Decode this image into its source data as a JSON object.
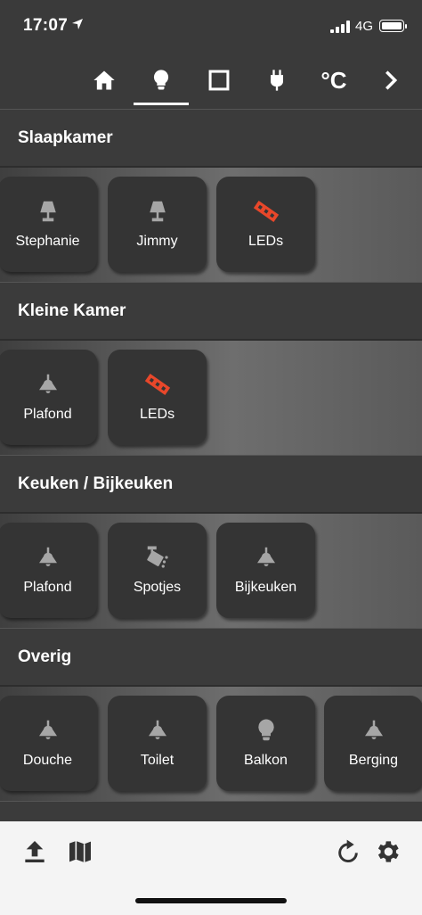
{
  "status_bar": {
    "time": "17:07",
    "network": "4G"
  },
  "top_tabs": [
    {
      "id": "home",
      "icon": "home-icon"
    },
    {
      "id": "lights",
      "icon": "lightbulb-icon",
      "active": true
    },
    {
      "id": "screens",
      "icon": "square-icon"
    },
    {
      "id": "plugs",
      "icon": "plug-icon"
    },
    {
      "id": "temperature",
      "icon": "celsius-icon",
      "label": "°C"
    },
    {
      "id": "more",
      "icon": "chevron-right-icon"
    }
  ],
  "rooms": [
    {
      "name": "Slaapkamer",
      "devices": [
        {
          "label": "Stephanie",
          "icon": "table-lamp-icon",
          "state": "off"
        },
        {
          "label": "Jimmy",
          "icon": "table-lamp-icon",
          "state": "off"
        },
        {
          "label": "LEDs",
          "icon": "led-strip-icon",
          "state": "on"
        }
      ]
    },
    {
      "name": "Kleine Kamer",
      "devices": [
        {
          "label": "Plafond",
          "icon": "ceiling-lamp-icon",
          "state": "off"
        },
        {
          "label": "LEDs",
          "icon": "led-strip-icon",
          "state": "on"
        }
      ]
    },
    {
      "name": "Keuken / Bijkeuken",
      "devices": [
        {
          "label": "Plafond",
          "icon": "ceiling-lamp-icon",
          "state": "off"
        },
        {
          "label": "Spotjes",
          "icon": "spotlight-icon",
          "state": "off"
        },
        {
          "label": "Bijkeuken",
          "icon": "ceiling-lamp-icon",
          "state": "off"
        }
      ]
    },
    {
      "name": "Overig",
      "devices": [
        {
          "label": "Douche",
          "icon": "ceiling-lamp-icon",
          "state": "off"
        },
        {
          "label": "Toilet",
          "icon": "ceiling-lamp-icon",
          "state": "off"
        },
        {
          "label": "Balkon",
          "icon": "lightbulb-icon",
          "state": "off"
        },
        {
          "label": "Berging",
          "icon": "ceiling-lamp-icon",
          "state": "off"
        }
      ]
    }
  ],
  "bottom_bar": [
    {
      "id": "upload",
      "icon": "upload-icon"
    },
    {
      "id": "map",
      "icon": "map-icon"
    },
    {
      "id": "refresh",
      "icon": "refresh-icon"
    },
    {
      "id": "settings",
      "icon": "gear-icon"
    }
  ],
  "colors": {
    "icon_off": "#aaaaaa",
    "icon_on": "#e8472a",
    "header_bg": "#3b3b3b",
    "tile_bg": "#343434"
  }
}
